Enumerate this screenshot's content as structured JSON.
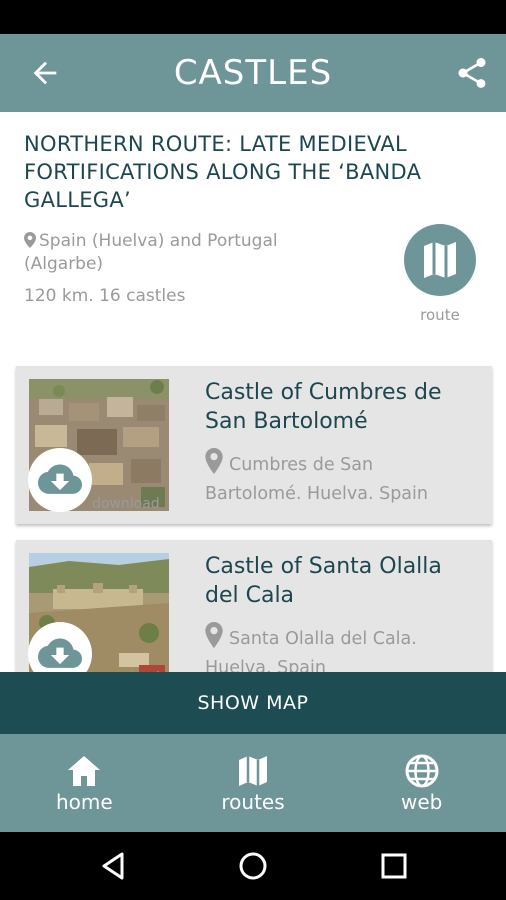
{
  "app_bar": {
    "title": "CASTLES",
    "back_icon": "arrow-back-icon",
    "share_icon": "share-icon"
  },
  "route": {
    "title": "NORTHERN ROUTE: LATE MEDIEVAL FORTIFICATIONS ALONG THE ‘BANDA GALLEGA’",
    "location": "Spain (Huelva) and Portugal (Algarbe)",
    "meta": "120 km. 16 castles",
    "route_button_label": "route"
  },
  "castles": [
    {
      "title": "Castle of Cumbres de San Bartolomé",
      "location": "Cumbres de San Bartolomé. Huelva. Spain",
      "download_label": "download"
    },
    {
      "title": "Castle of Santa Olalla del Cala",
      "location": "Santa Olalla del Cala. Huelva. Spain",
      "download_label": "download"
    }
  ],
  "show_map_label": "SHOW MAP",
  "bottom_nav": [
    {
      "label": "home",
      "icon": "home-icon"
    },
    {
      "label": "routes",
      "icon": "map-icon"
    },
    {
      "label": "web",
      "icon": "globe-icon"
    }
  ],
  "colors": {
    "primary": "#6e9598",
    "dark": "#1d4d52",
    "title_text": "#1d4750",
    "muted_text": "#9a9a9a",
    "card_bg": "#e5e5e5"
  }
}
